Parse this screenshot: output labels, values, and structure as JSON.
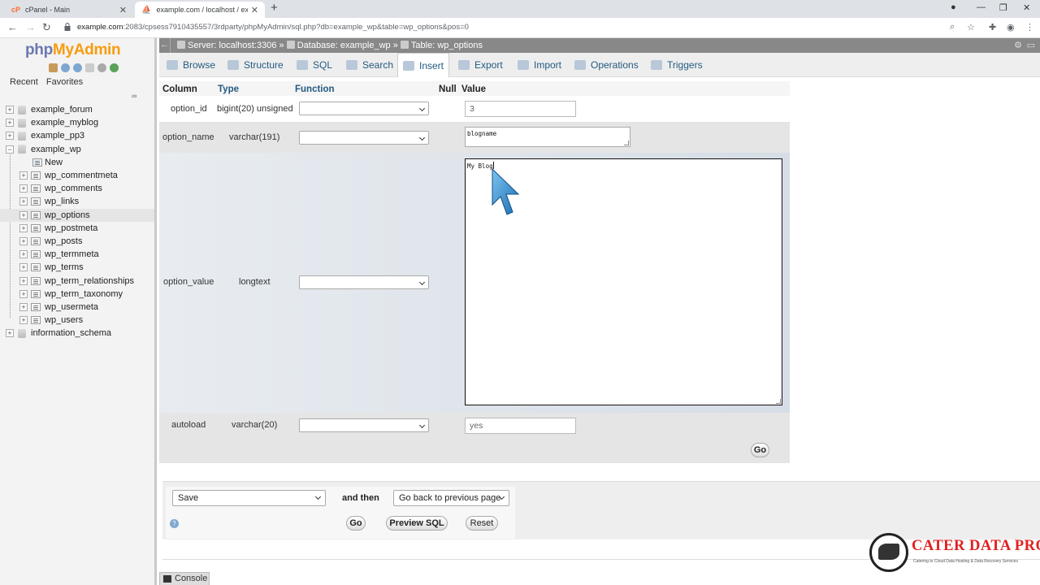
{
  "browser": {
    "tabs": [
      {
        "title": "cPanel - Main",
        "active": false
      },
      {
        "title": "example.com / localhost / example_wp / wp_options",
        "active": true
      }
    ],
    "url_host": "example.com",
    "url_rest": ":2083/cpsess7910435557/3rdparty/phpMyAdmin/sql.php?db=example_wp&table=wp_options&pos=0"
  },
  "sidebar": {
    "logo_php": "php",
    "logo_my": "My",
    "logo_admin": "Admin",
    "recent": "Recent",
    "favorites": "Favorites",
    "databases": [
      {
        "name": "example_forum",
        "expanded": false
      },
      {
        "name": "example_myblog",
        "expanded": false
      },
      {
        "name": "example_pp3",
        "expanded": false
      },
      {
        "name": "example_wp",
        "expanded": true
      }
    ],
    "new_label": "New",
    "tables": [
      "wp_commentmeta",
      "wp_comments",
      "wp_links",
      "wp_options",
      "wp_postmeta",
      "wp_posts",
      "wp_termmeta",
      "wp_terms",
      "wp_term_relationships",
      "wp_term_taxonomy",
      "wp_usermeta",
      "wp_users"
    ],
    "selected_table": "wp_options",
    "last_db": "information_schema"
  },
  "breadcrumb": {
    "server": "Server: localhost:3306",
    "database": "Database: example_wp",
    "table": "Table: wp_options",
    "sep": "»"
  },
  "tabs": [
    "Browse",
    "Structure",
    "SQL",
    "Search",
    "Insert",
    "Export",
    "Import",
    "Operations",
    "Triggers"
  ],
  "active_tab": "Insert",
  "form": {
    "headers": {
      "column": "Column",
      "type": "Type",
      "function": "Function",
      "null": "Null",
      "value": "Value"
    },
    "rows": [
      {
        "column": "option_id",
        "type": "bigint(20) unsigned",
        "value": "3"
      },
      {
        "column": "option_name",
        "type": "varchar(191)",
        "value": "blogname"
      },
      {
        "column": "option_value",
        "type": "longtext",
        "value": "My Blog"
      },
      {
        "column": "autoload",
        "type": "varchar(20)",
        "value": "yes"
      }
    ],
    "go_label": "Go"
  },
  "bottom": {
    "action": "Save",
    "and_then": "and then",
    "after": "Go back to previous page",
    "go": "Go",
    "preview": "Preview SQL",
    "reset": "Reset"
  },
  "console": "Console",
  "watermark": {
    "brand": "CATER DATA PRO",
    "tagline": "Catering to Cloud Data Hosting & Data Recovery Services"
  },
  "colors": {
    "link": "#235a81",
    "breadcrumb_bg": "#888888",
    "brand_red": "#e02020",
    "logo_orange": "#f89c0e",
    "logo_blue": "#6c78af"
  }
}
